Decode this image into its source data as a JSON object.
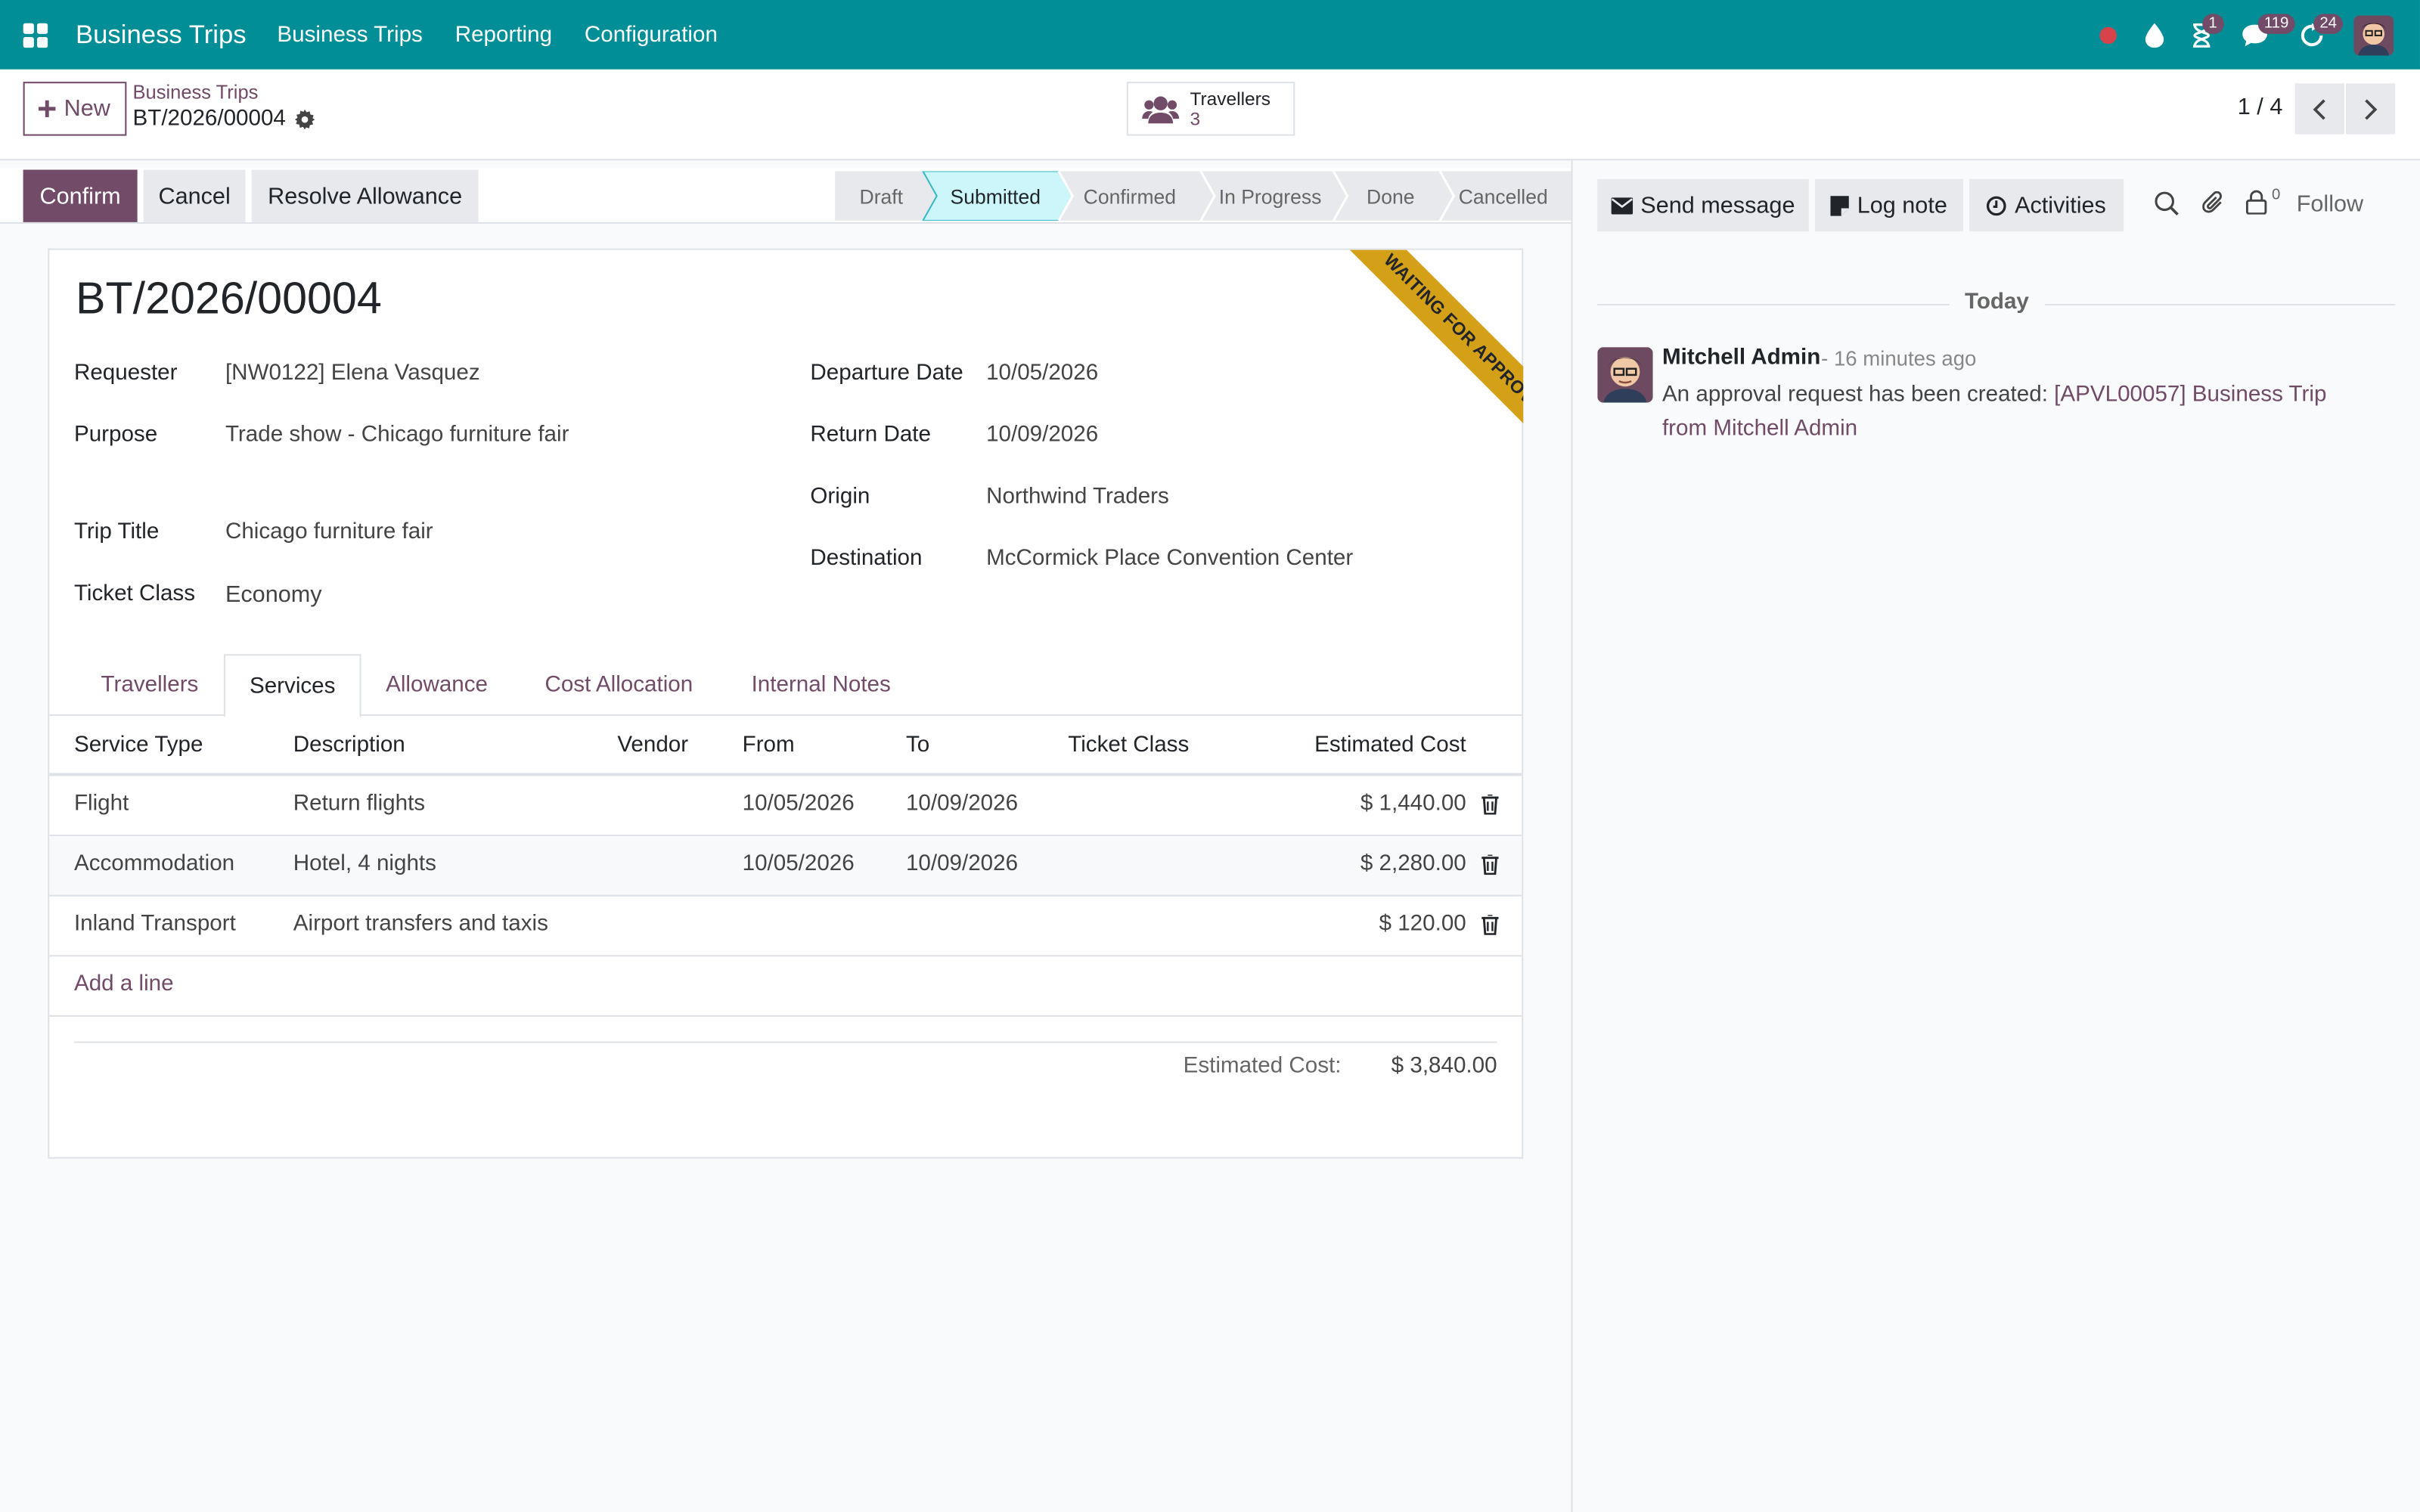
{
  "navbar": {
    "brand": "Business Trips",
    "menu": [
      "Business Trips",
      "Reporting",
      "Configuration"
    ],
    "badges": {
      "activities": "1",
      "messages": "119",
      "updates": "24"
    },
    "color": "#018e96"
  },
  "control": {
    "new_label": "New",
    "breadcrumb_parent": "Business Trips",
    "breadcrumb_current": "BT/2026/00004",
    "smart_button": {
      "label": "Travellers",
      "value": "3"
    },
    "pager": "1 / 4"
  },
  "status": {
    "actions": [
      "Confirm",
      "Cancel",
      "Resolve Allowance"
    ],
    "stages": [
      "Draft",
      "Submitted",
      "Confirmed",
      "In Progress",
      "Done",
      "Cancelled"
    ],
    "current_stage": "Submitted",
    "accent": "#714b67"
  },
  "form": {
    "ribbon": "WAITING FOR APPROVAL",
    "title": "BT/2026/00004",
    "left": [
      {
        "label": "Requester",
        "value": "[NW0122] Elena Vasquez"
      },
      {
        "label": "Purpose",
        "value": "Trade show - Chicago furniture fair"
      },
      {
        "label": "Trip Title",
        "value": "Chicago furniture fair"
      },
      {
        "label": "Ticket Class",
        "value": "Economy"
      }
    ],
    "right": [
      {
        "label": "Departure Date",
        "value": "10/05/2026"
      },
      {
        "label": "Return Date",
        "value": "10/09/2026"
      },
      {
        "label": "Origin",
        "value": "Northwind Traders"
      },
      {
        "label": "Destination",
        "value": "McCormick Place Convention Center"
      }
    ],
    "tabs": [
      "Travellers",
      "Services",
      "Allowance",
      "Cost Allocation",
      "Internal Notes"
    ],
    "active_tab": "Services"
  },
  "services": {
    "columns": [
      "Service Type",
      "Description",
      "Vendor",
      "From",
      "To",
      "Ticket Class",
      "Estimated Cost"
    ],
    "rows": [
      {
        "type": "Flight",
        "description": "Return flights",
        "vendor": "",
        "from": "10/05/2026",
        "to": "10/09/2026",
        "ticket_class": "",
        "cost": "$ 1,440.00"
      },
      {
        "type": "Accommodation",
        "description": "Hotel, 4 nights",
        "vendor": "",
        "from": "10/05/2026",
        "to": "10/09/2026",
        "ticket_class": "",
        "cost": "$ 2,280.00"
      },
      {
        "type": "Inland Transport",
        "description": "Airport transfers and taxis",
        "vendor": "",
        "from": "",
        "to": "",
        "ticket_class": "",
        "cost": "$ 120.00"
      }
    ],
    "add_line": "Add a line",
    "total_label": "Estimated Cost:",
    "total_value": "$ 3,840.00"
  },
  "chatter": {
    "send_message": "Send message",
    "log_note": "Log note",
    "activities": "Activities",
    "followers_count": "0",
    "follow": "Follow",
    "date_separator": "Today",
    "message": {
      "author": "Mitchell Admin",
      "time": "- 16 minutes ago",
      "text": "An approval request has been created:",
      "link": "[APVL00057] Business Trip from Mitchell Admin"
    }
  }
}
